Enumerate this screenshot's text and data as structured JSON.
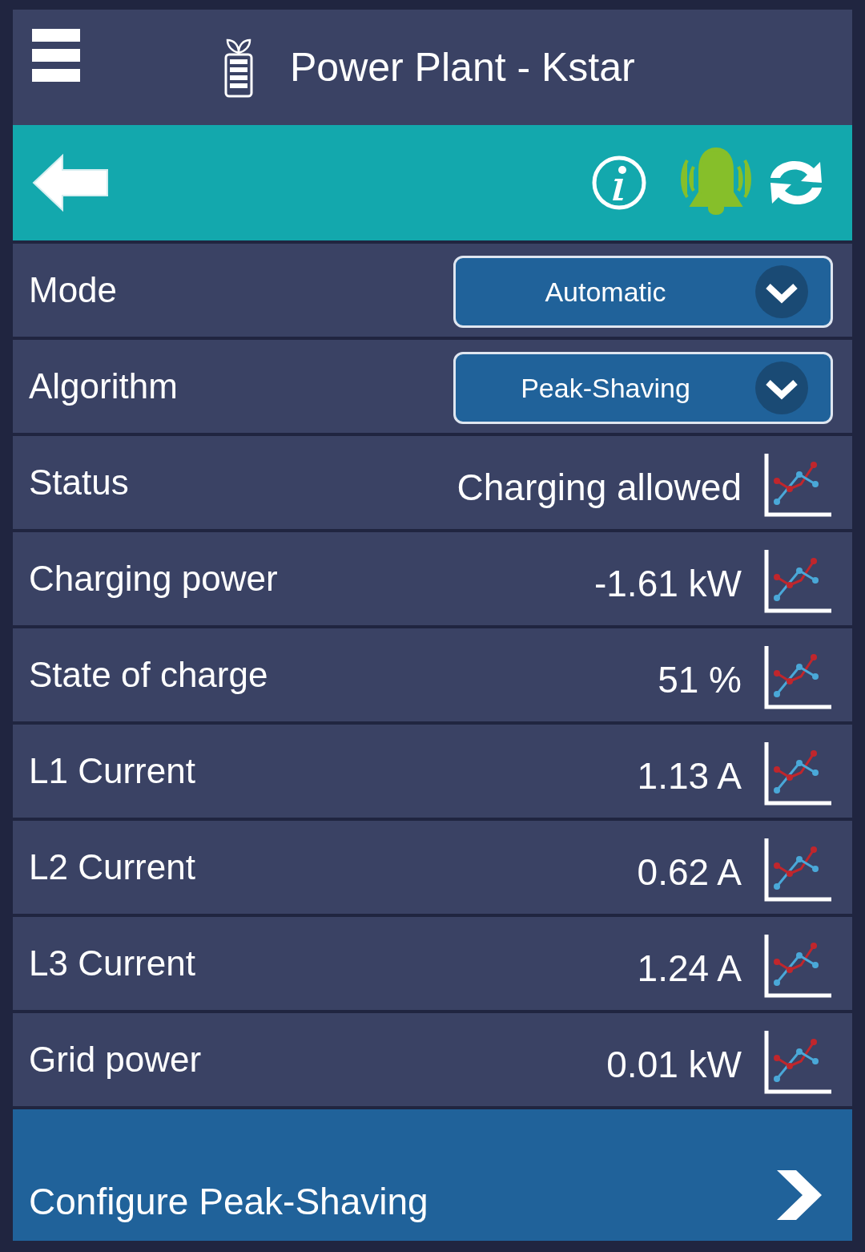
{
  "header": {
    "title": "Power Plant - Kstar"
  },
  "rows": [
    {
      "kind": "select",
      "label": "Mode",
      "value": "Automatic"
    },
    {
      "kind": "select",
      "label": "Algorithm",
      "value": "Peak-Shaving"
    },
    {
      "kind": "value",
      "label": "Status",
      "value": "Charging allowed"
    },
    {
      "kind": "value",
      "label": "Charging power",
      "value": "-1.61 kW"
    },
    {
      "kind": "value",
      "label": "State of charge",
      "value": "51 %"
    },
    {
      "kind": "value",
      "label": "L1 Current",
      "value": "1.13 A"
    },
    {
      "kind": "value",
      "label": "L2 Current",
      "value": "0.62 A"
    },
    {
      "kind": "value",
      "label": "L3 Current",
      "value": "1.24 A"
    },
    {
      "kind": "value",
      "label": "Grid power",
      "value": "0.01 kW"
    }
  ],
  "footer": {
    "label": "Configure Peak-Shaving"
  }
}
